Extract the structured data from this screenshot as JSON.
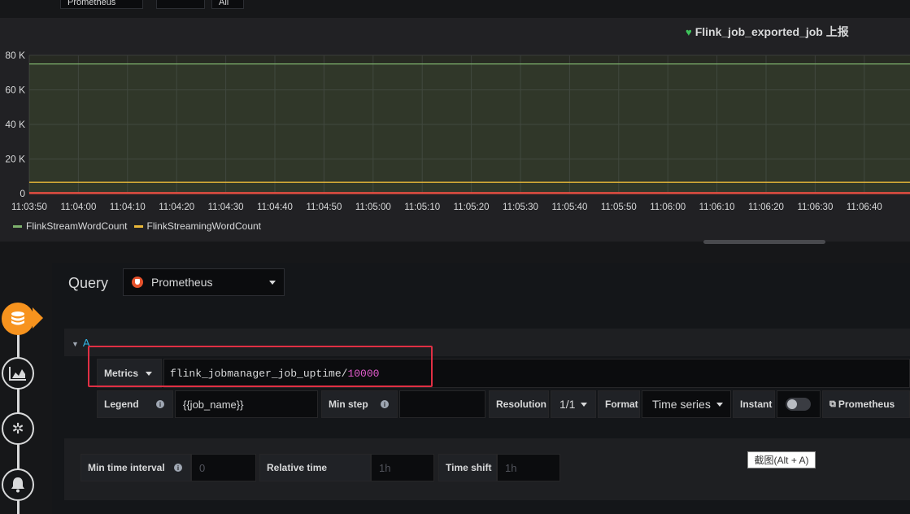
{
  "top": {
    "datasource_value": "Prometheus",
    "second_value": "All"
  },
  "panel": {
    "title": "Flink_job_exported_job 上报"
  },
  "chart_data": {
    "type": "line",
    "title": "Flink_job_exported_job 上报",
    "x": [
      "11:03:50",
      "11:04:00",
      "11:04:10",
      "11:04:20",
      "11:04:30",
      "11:04:40",
      "11:04:50",
      "11:05:00",
      "11:05:10",
      "11:05:20",
      "11:05:30",
      "11:05:40",
      "11:05:50",
      "11:06:00",
      "11:06:10",
      "11:06:20",
      "11:06:30",
      "11:06:40"
    ],
    "yticks": [
      "0",
      "20 K",
      "40 K",
      "60 K",
      "80 K"
    ],
    "ylim": [
      0,
      80000
    ],
    "grid": true,
    "legend_position": "bottom-left",
    "series": [
      {
        "name": "FlinkStreamWordCount",
        "color": "#7eb26d",
        "value": 75000
      },
      {
        "name": "FlinkStreamingWordCount",
        "color": "#eab839",
        "value": 6500
      },
      {
        "name": "",
        "color": "#e24d42",
        "value": 300
      }
    ]
  },
  "query": {
    "label": "Query",
    "datasource": "Prometheus",
    "row_label": "A",
    "metrics_label": "Metrics",
    "metric_expr": "flink_jobmanager_job_uptime/",
    "metric_num": "10000",
    "legend_label": "Legend",
    "legend_value": "{{job_name}}",
    "min_step_label": "Min step",
    "min_step_value": "",
    "resolution_label": "Resolution",
    "resolution_value": "1/1",
    "format_label": "Format",
    "format_value": "Time series",
    "instant_label": "Instant",
    "instant_on": false,
    "prom_link": "Prometheus"
  },
  "options": {
    "min_interval_label": "Min time interval",
    "min_interval_placeholder": "0",
    "relative_label": "Relative time",
    "relative_placeholder": "1h",
    "shift_label": "Time shift",
    "shift_placeholder": "1h"
  },
  "tooltip": "截图(Alt + A)",
  "icons": [
    "database-icon",
    "visualization-icon",
    "settings-icon",
    "alert-bell-icon",
    "info-icon",
    "heart-icon",
    "prometheus-icon"
  ]
}
